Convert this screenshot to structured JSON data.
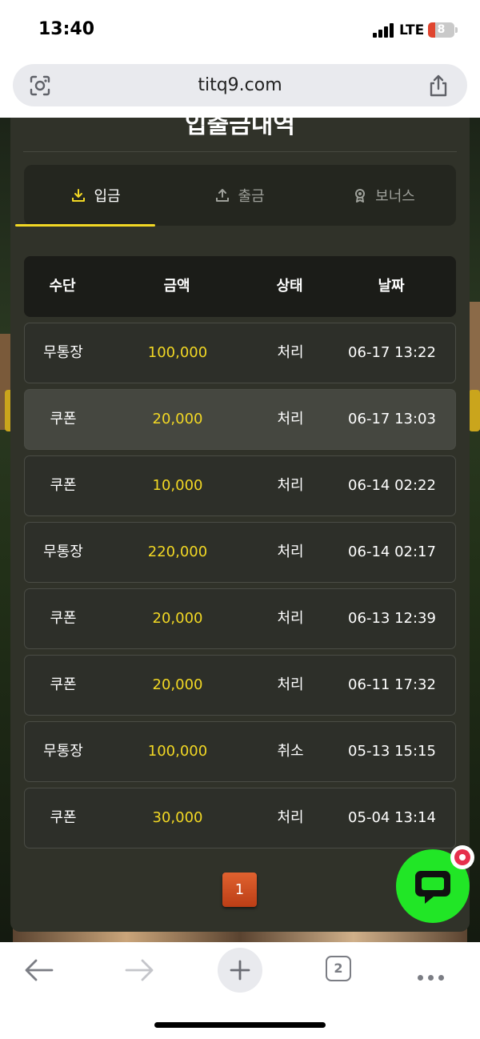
{
  "status_bar": {
    "time": "13:40",
    "network": "LTE",
    "battery": "8"
  },
  "browser": {
    "url": "titq9.com",
    "tab_count": "2"
  },
  "modal": {
    "title": "입출금내역",
    "tabs": [
      {
        "label": "입금",
        "icon": "download-icon",
        "active": true
      },
      {
        "label": "출금",
        "icon": "upload-icon",
        "active": false
      },
      {
        "label": "보너스",
        "icon": "medal-icon",
        "active": false
      }
    ],
    "columns": [
      "수단",
      "금액",
      "상태",
      "날짜"
    ],
    "rows": [
      {
        "method": "무통장",
        "amount": "100,000",
        "status": "처리",
        "date": "06-17 13:22"
      },
      {
        "method": "쿠폰",
        "amount": "20,000",
        "status": "처리",
        "date": "06-17 13:03"
      },
      {
        "method": "쿠폰",
        "amount": "10,000",
        "status": "처리",
        "date": "06-14 02:22"
      },
      {
        "method": "무통장",
        "amount": "220,000",
        "status": "처리",
        "date": "06-14 02:17"
      },
      {
        "method": "쿠폰",
        "amount": "20,000",
        "status": "처리",
        "date": "06-13 12:39"
      },
      {
        "method": "쿠폰",
        "amount": "20,000",
        "status": "처리",
        "date": "06-11 17:32"
      },
      {
        "method": "무통장",
        "amount": "100,000",
        "status": "취소",
        "date": "05-13 15:15"
      },
      {
        "method": "쿠폰",
        "amount": "30,000",
        "status": "처리",
        "date": "05-04 13:14"
      }
    ],
    "pagination": {
      "current_page": "1"
    }
  },
  "colors": {
    "accent": "#f2d824",
    "modal_bg": "#303229",
    "page_button": "#d4522a",
    "chat_button": "#21e626"
  }
}
